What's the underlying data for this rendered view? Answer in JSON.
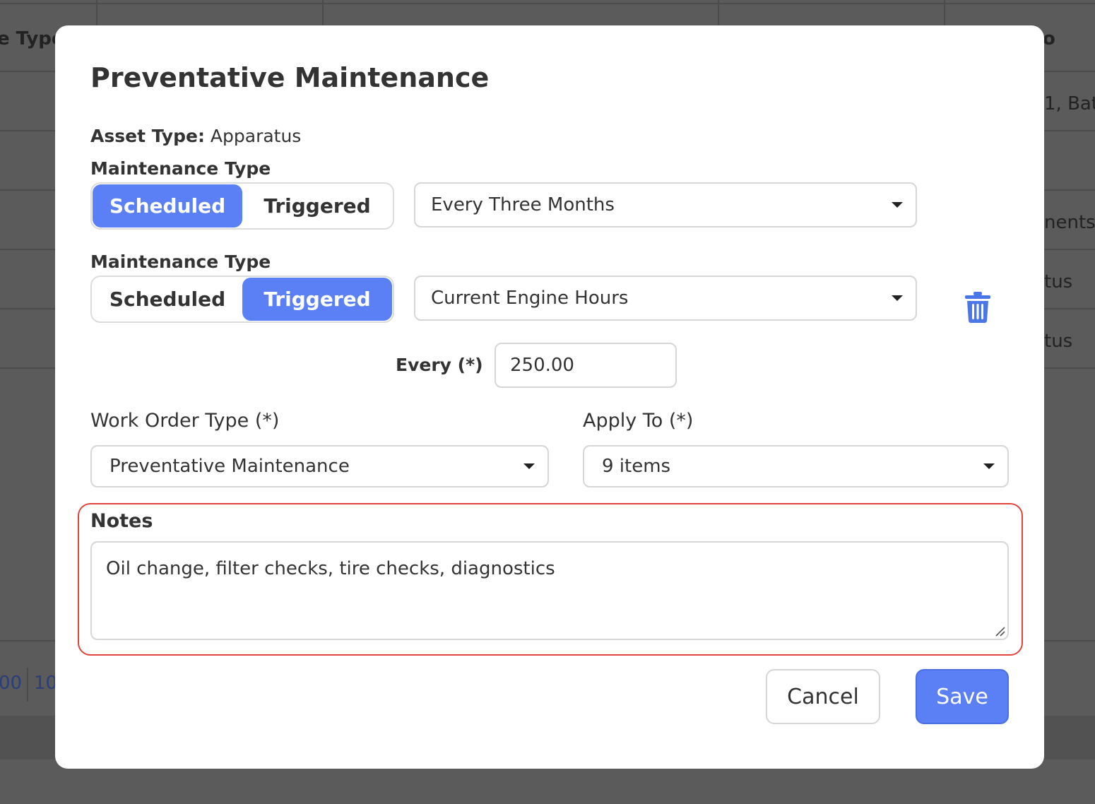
{
  "background": {
    "header_fragments": [
      "e Type",
      "o"
    ],
    "row_fragments": [
      "1, Batt",
      "nents",
      "tus",
      "tus"
    ],
    "pager_fragments": [
      "00",
      "10"
    ]
  },
  "modal": {
    "title": "Preventative Maintenance",
    "asset_type_label": "Asset Type:",
    "asset_type_value": "Apparatus",
    "maintenance_rows": [
      {
        "label": "Maintenance Type",
        "options": [
          "Scheduled",
          "Triggered"
        ],
        "active": "Scheduled",
        "select_value": "Every Three Months"
      },
      {
        "label": "Maintenance Type",
        "options": [
          "Scheduled",
          "Triggered"
        ],
        "active": "Triggered",
        "select_value": "Current Engine Hours"
      }
    ],
    "every_label": "Every (*)",
    "every_value": "250.00",
    "work_order_type_label": "Work Order Type (*)",
    "work_order_type_value": "Preventative Maintenance",
    "apply_to_label": "Apply To (*)",
    "apply_to_value": "9 items",
    "notes_label": "Notes",
    "notes_value": "Oil change, filter checks, tire checks, diagnostics",
    "cancel_label": "Cancel",
    "save_label": "Save"
  },
  "colors": {
    "accent": "#5b7ff5",
    "highlight": "#e0453a",
    "trash_icon": "#4a76e8"
  }
}
